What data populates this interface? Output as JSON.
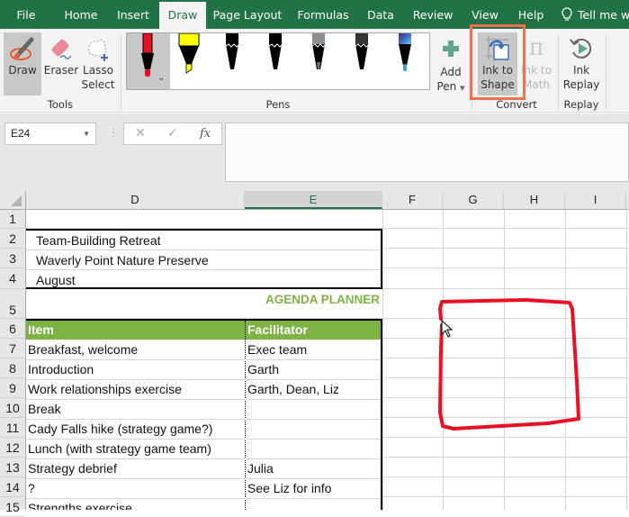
{
  "tabs": [
    {
      "label": "File",
      "active": false
    },
    {
      "label": "Home",
      "active": false
    },
    {
      "label": "Insert",
      "active": false
    },
    {
      "label": "Draw",
      "active": true
    },
    {
      "label": "Page Layout",
      "active": false
    },
    {
      "label": "Formulas",
      "active": false
    },
    {
      "label": "Data",
      "active": false
    },
    {
      "label": "Review",
      "active": false
    },
    {
      "label": "View",
      "active": false
    },
    {
      "label": "Help",
      "active": false
    }
  ],
  "tell_me": "Tell me w",
  "ribbon": {
    "tools": {
      "group_label": "Tools",
      "draw": "Draw",
      "eraser": "Eraser",
      "lasso_line1": "Lasso",
      "lasso_line2": "Select"
    },
    "pens": {
      "group_label": "Pens",
      "items": [
        {
          "name": "red-pen",
          "color": "#e81123",
          "selected": true
        },
        {
          "name": "yellow-highlighter",
          "color": "#ffff00",
          "selected": false
        },
        {
          "name": "black-pencil-1",
          "color": "#000000",
          "selected": false
        },
        {
          "name": "black-pencil-2",
          "color": "#000000",
          "selected": false
        },
        {
          "name": "gray-pencil",
          "color": "#8a8f93",
          "selected": false
        },
        {
          "name": "dark-gray-pencil",
          "color": "#333333",
          "selected": false
        },
        {
          "name": "galaxy-pen",
          "color": "#3aa0c8",
          "selected": false
        }
      ],
      "add_pen_line1": "Add",
      "add_pen_line2": "Pen"
    },
    "convert": {
      "group_label": "Convert",
      "ink_to_shape_line1": "Ink to",
      "ink_to_shape_line2": "Shape",
      "ink_to_math_line1": "Ink to",
      "ink_to_math_line2": "Math"
    },
    "replay": {
      "group_label": "Replay",
      "ink_replay_line1": "Ink",
      "ink_replay_line2": "Replay"
    }
  },
  "formula_bar": {
    "name_box": "E24",
    "cancel": "✕",
    "enter": "✓",
    "fx": "fx",
    "value": ""
  },
  "columns": [
    {
      "label": "D",
      "selected": false
    },
    {
      "label": "E",
      "selected": true
    },
    {
      "label": "F",
      "selected": false
    },
    {
      "label": "G",
      "selected": false
    },
    {
      "label": "H",
      "selected": false
    },
    {
      "label": "I",
      "selected": false
    }
  ],
  "rows": [
    "1",
    "2",
    "3",
    "4",
    "5",
    "6",
    "7",
    "8",
    "9",
    "10",
    "11",
    "12",
    "13",
    "14",
    "15"
  ],
  "sheet": {
    "info": [
      "Team-Building Retreat",
      "Waverly Point Nature Preserve",
      "August"
    ],
    "planner_title": "AGENDA PLANNER",
    "header": {
      "item": "Item",
      "facilitator": "Facilitator"
    },
    "agenda": [
      {
        "item": "Breakfast, welcome",
        "facilitator": "Exec team"
      },
      {
        "item": "Introduction",
        "facilitator": "Garth"
      },
      {
        "item": "Work relationships exercise",
        "facilitator": "Garth, Dean, Liz"
      },
      {
        "item": "Break",
        "facilitator": ""
      },
      {
        "item": "Cady Falls hike (strategy game?)",
        "facilitator": ""
      },
      {
        "item": "Lunch (with strategy game team)",
        "facilitator": ""
      },
      {
        "item": "Strategy debrief",
        "facilitator": "Julia"
      },
      {
        "item": "?",
        "facilitator": "See Liz for info"
      },
      {
        "item": "Strengths exercise",
        "facilitator": ""
      }
    ]
  },
  "colors": {
    "excel_green": "#217346",
    "header_green": "#7cb342",
    "ink_red": "#e81123",
    "highlight_orange": "#f26f4f"
  }
}
